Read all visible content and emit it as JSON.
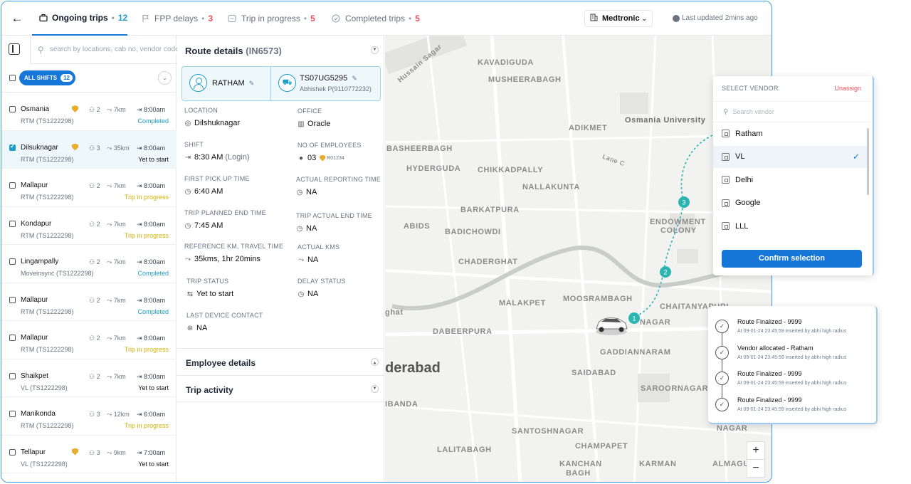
{
  "topbar": {
    "tabs": [
      {
        "label": "Ongoing trips",
        "count": "12"
      },
      {
        "label": "FPP delays",
        "count": "3"
      },
      {
        "label": "Trip in progress",
        "count": "5"
      },
      {
        "label": "Completed trips",
        "count": "5"
      }
    ],
    "client": "Medtronic",
    "last_updated": "Last updated 2mins ago"
  },
  "left": {
    "search_placeholder": "search by locations, cab no, vendor code",
    "all_shifts_label": "ALL SHIFTS",
    "all_shifts_count": "12",
    "trips": [
      {
        "name": "Osmania",
        "escort": true,
        "emp": "2",
        "km": "7km",
        "time": "8:00am",
        "vehicle": "RTM (TS1222298)",
        "status": "Completed",
        "status_type": "completed",
        "checked": false
      },
      {
        "name": "Dilsuknagar",
        "escort": true,
        "emp": "3",
        "km": "35km",
        "time": "8:00am",
        "vehicle": "RTM (TS1222298)",
        "status": "Yet to start",
        "status_type": "yet",
        "checked": true
      },
      {
        "name": "Mallapur",
        "escort": false,
        "emp": "2",
        "km": "7km",
        "time": "8:00am",
        "vehicle": "RTM (TS1222298)",
        "status": "Trip in progress",
        "status_type": "progress",
        "checked": false
      },
      {
        "name": "Kondapur",
        "escort": false,
        "emp": "2",
        "km": "7km",
        "time": "8:00am",
        "vehicle": "RTM (TS1222298)",
        "status": "Trip in progress",
        "status_type": "progress",
        "checked": false
      },
      {
        "name": "Lingampally",
        "escort": false,
        "emp": "2",
        "km": "7km",
        "time": "8:00am",
        "vehicle": "Moveinsync (TS1222298)",
        "status": "Completed",
        "status_type": "completed",
        "checked": false
      },
      {
        "name": "Mallapur",
        "escort": false,
        "emp": "2",
        "km": "7km",
        "time": "8:00am",
        "vehicle": "RTM (TS1222298)",
        "status": "Completed",
        "status_type": "completed",
        "checked": false
      },
      {
        "name": "Mallapur",
        "escort": false,
        "emp": "2",
        "km": "7km",
        "time": "8:00am",
        "vehicle": "RTM (TS1222298)",
        "status": "Trip in progress",
        "status_type": "progress",
        "checked": false
      },
      {
        "name": "Shaikpet",
        "escort": false,
        "emp": "2",
        "km": "7km",
        "time": "8:00am",
        "vehicle": "VL (TS1222298)",
        "status": "Yet to start",
        "status_type": "yet",
        "checked": false
      },
      {
        "name": "Manikonda",
        "escort": false,
        "emp": "3",
        "km": "12km",
        "time": "6:00am",
        "vehicle": "RTM (TS1222298)",
        "status": "Trip in progress",
        "status_type": "progress",
        "checked": false
      },
      {
        "name": "Tellapur",
        "escort": true,
        "emp": "3",
        "km": "9km",
        "time": "7:00am",
        "vehicle": "VL (TS1222298)",
        "status": "Yet to start",
        "status_type": "yet",
        "checked": false
      }
    ]
  },
  "route": {
    "title": "Route details",
    "route_id": "(IN6573)",
    "vendor_name": "RATHAM",
    "vehicle_plate": "TS07UG5295",
    "driver": "Abhishek P(9110772232)",
    "fields": {
      "location": {
        "label": "LOCATION",
        "value": "Dilshuknagar"
      },
      "office": {
        "label": "OFFICE",
        "value": "Oracle"
      },
      "shift": {
        "label": "SHIFT",
        "value": "8:30 AM",
        "suffix": "(Login)"
      },
      "employees": {
        "label": "NO OF EMPLOYEES",
        "value": "03",
        "code": "R01234"
      },
      "first_pickup": {
        "label": "FIRST PICK UP TIME",
        "value": "6:40 AM"
      },
      "actual_reporting": {
        "label": "ACTUAL REPORTING TIME",
        "value": "NA"
      },
      "planned_end": {
        "label": "TRIP PLANNED END TIME",
        "value": "7:45 AM"
      },
      "actual_end": {
        "label": "TRIP ACTUAL END TIME",
        "value": "NA"
      },
      "reference_km": {
        "label": "REFERENCE KM, TRAVEL TIME",
        "value": "35kms, 1hr 20mins"
      },
      "actual_kms": {
        "label": "ACTUAL KMS",
        "value": "NA"
      },
      "trip_status": {
        "label": "TRIP STATUS",
        "value": "Yet to start"
      },
      "delay_status": {
        "label": "DELAY STATUS",
        "value": "NA"
      },
      "last_contact": {
        "label": "LAST DEVICE CONTACT",
        "value": "NA"
      }
    },
    "sections": {
      "employee_details": "Employee details",
      "trip_activity": "Trip activity"
    }
  },
  "map": {
    "places": {
      "hussain_sagar": "Hussain Sagar",
      "kavadiguda": "KAVADIGUDA",
      "musheerabagh": "MUSHEERABAGH",
      "osmania_university": "Osmania University",
      "adikmet": "ADIKMET",
      "basheerbagh": "BASHEERBAGH",
      "lane_c": "Lane C",
      "hyderguda": "HYDERGUDA",
      "chikkadpally": "CHIKKADPALLY",
      "nallakunta": "NALLAKUNTA",
      "barkatpura": "BARKATPURA",
      "abids": "ABIDS",
      "badichowdi": "BADICHOWDI",
      "endowment_colony_1": "ENDOWMENT",
      "endowment_colony_2": "COLONY",
      "chaderghat": "CHADERGHAT",
      "malakpet": "MALAKPET",
      "moosrambagh": "MOOSRAMBAGH",
      "chaitanyapuri": "CHAITANYAPURI",
      "dilsuknagar_partial": "NAGAR",
      "ghat_partial": "ghat",
      "dabeerpura": "DABEERPURA",
      "gaddiannaram": "GADDIANNARAM",
      "hyderabad_partial": "derabad",
      "saidabad": "SAIDABAD",
      "saroornagar": "SAROORNAGAR",
      "ibanda_partial": "IBANDA",
      "santoshnagar": "SANTOSHNAGAR",
      "nagar_partial": "NAGAR",
      "champapet": "CHAMPAPET",
      "lalitabagh": "LALITABAGH",
      "kanchan_bagh_1": "KANCHAN",
      "kanchan_bagh_2": "BAGH",
      "karmanghat_partial": "KARMAN",
      "almasguda_partial": "ALMAGU"
    },
    "stops": [
      "1",
      "2",
      "3"
    ],
    "zoom_in": "+",
    "zoom_out": "−"
  },
  "vendor_dropdown": {
    "header": "SELECT VENDOR",
    "unassign": "Unassign",
    "search_placeholder": "Search vendor",
    "items": [
      "Ratham",
      "VL",
      "Delhi",
      "Google",
      "LLL"
    ],
    "selected": "VL",
    "confirm": "Confirm selection"
  },
  "activity": {
    "items": [
      {
        "title": "Route Finalized - 9999",
        "sub": "At 09-01-24 23:45:59 inserted by abhi high radius"
      },
      {
        "title": "Vendor allocated - Ratham",
        "sub": "At 09-01-24 23:45:59 inserted by abhi high radius"
      },
      {
        "title": "Route Finalized - 9999",
        "sub": "At 09-01-24 23:45:59 inserted by abhi high radius"
      },
      {
        "title": "Route Finalized - 9999",
        "sub": "At 09-01-24 23:45:59 inserted by abhi high radius"
      }
    ]
  },
  "colors": {
    "primary": "#1677d9",
    "teal": "#1a9ec9",
    "warning": "#d4b106",
    "danger": "#e8505b",
    "route_dots": "#2bb5b0"
  }
}
